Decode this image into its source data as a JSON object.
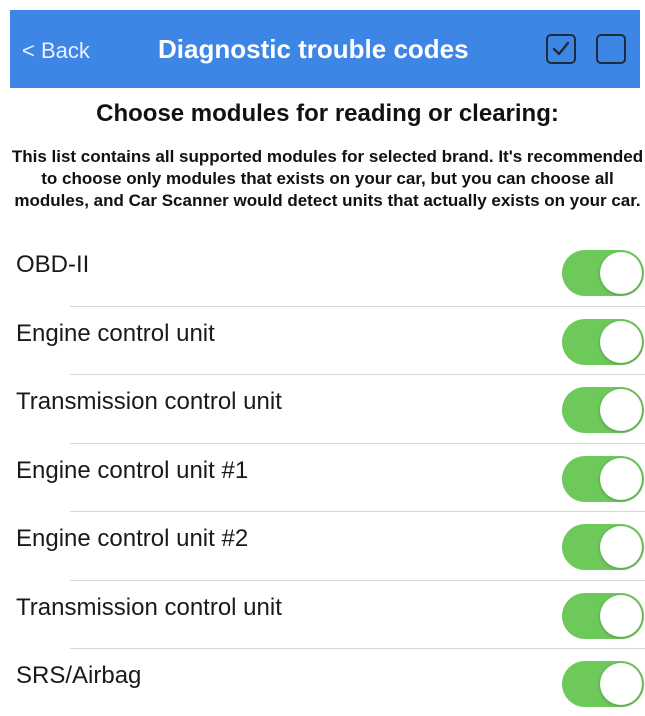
{
  "header": {
    "back_label": "< Back",
    "title": "Diagnostic trouble codes",
    "select_all_icon": "checked-checkbox-icon",
    "deselect_all_icon": "empty-checkbox-icon",
    "background_color": "#3e86e6"
  },
  "content": {
    "heading": "Choose modules for reading or clearing:",
    "description": "This list contains all supported modules for selected brand. It's recommended to choose only modules that exists on your car, but you can choose all modules, and Car Scanner would detect units that actually exists on your car."
  },
  "modules": [
    {
      "label": "OBD-II",
      "enabled": true
    },
    {
      "label": "Engine control unit",
      "enabled": true
    },
    {
      "label": "Transmission control unit",
      "enabled": true
    },
    {
      "label": "Engine control unit #1",
      "enabled": true
    },
    {
      "label": "Engine control unit #2",
      "enabled": true
    },
    {
      "label": "Transmission control unit",
      "enabled": true
    },
    {
      "label": "SRS/Airbag",
      "enabled": true
    }
  ],
  "colors": {
    "toggle_on": "#6cc95a"
  }
}
